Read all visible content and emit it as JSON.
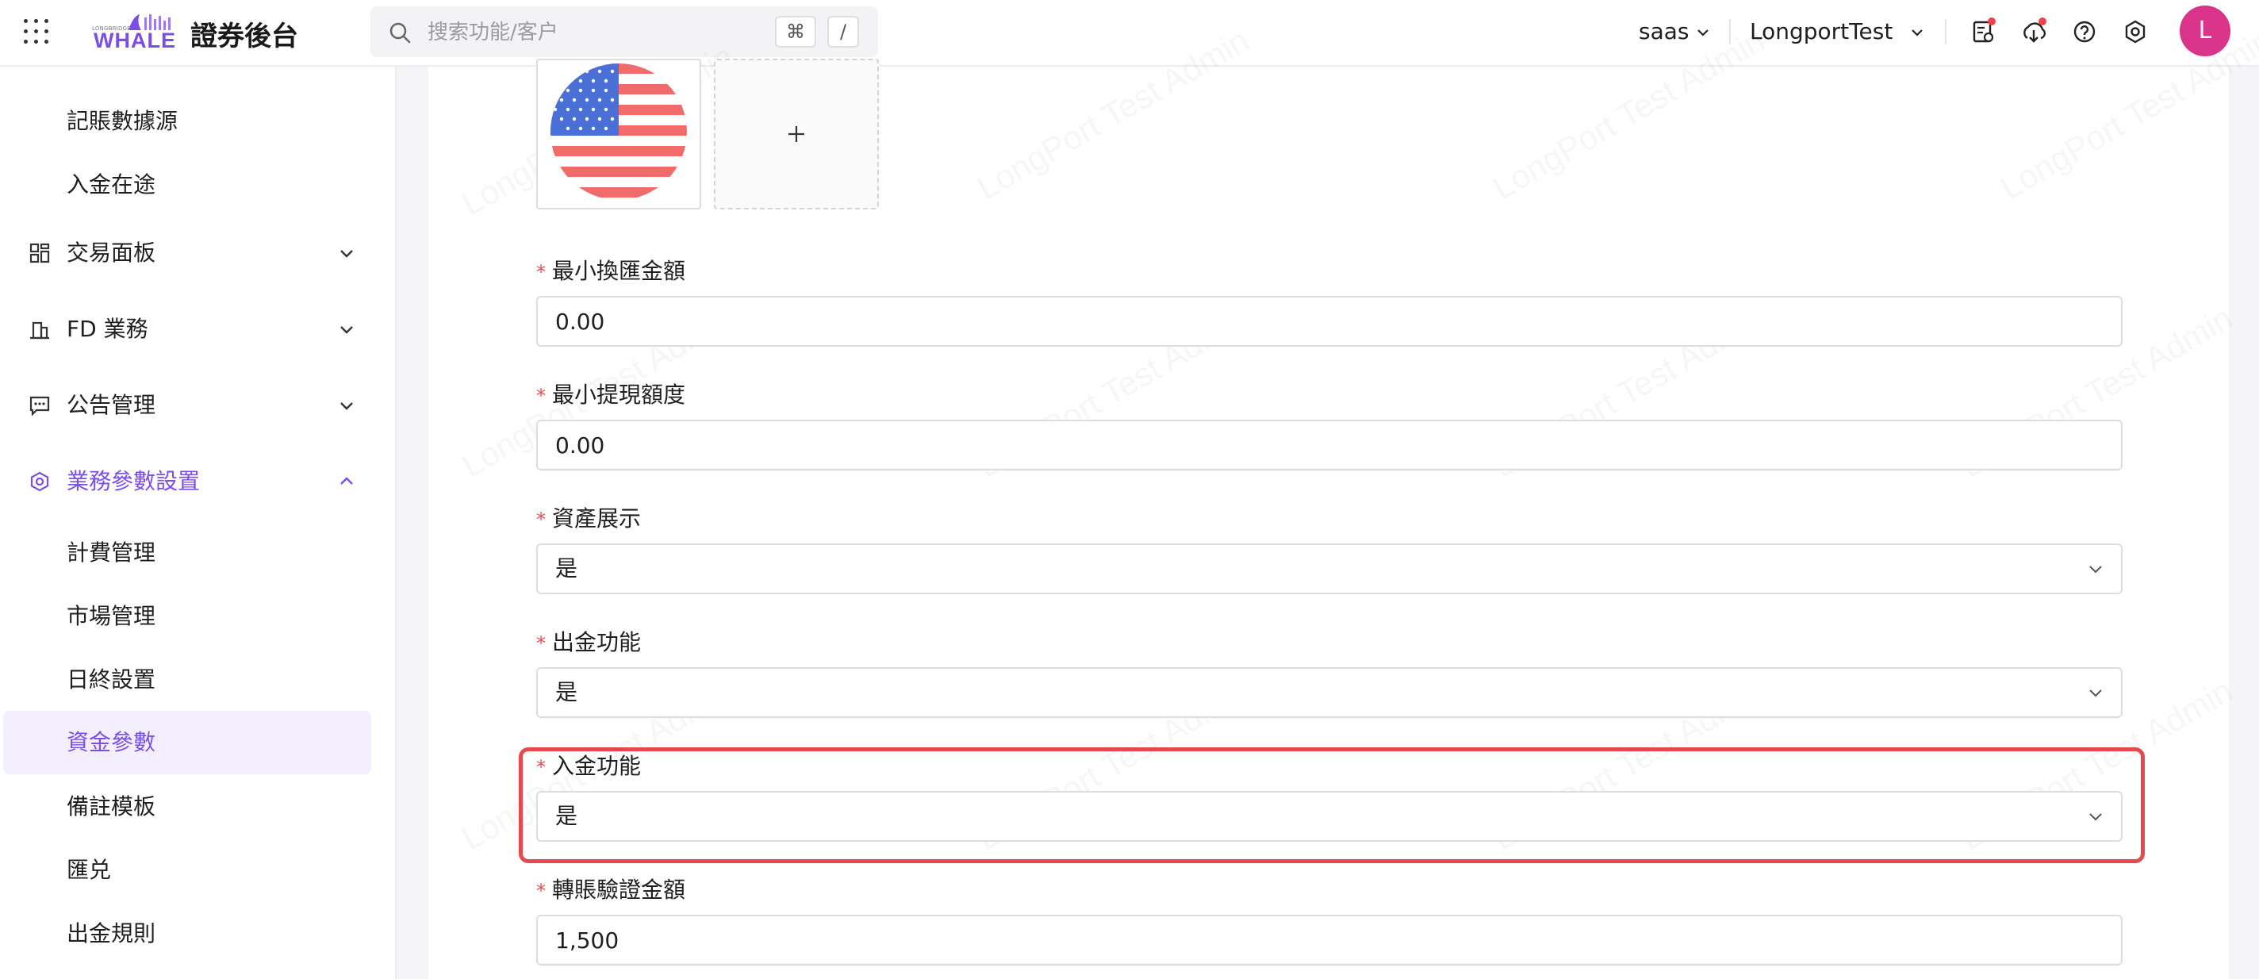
{
  "header": {
    "logo_small_text": "LONGBRIDGE",
    "logo_text": "WHALE",
    "app_title": "證券後台",
    "search_placeholder": "搜索功能/客户",
    "shortcut_key_1": "⌘",
    "shortcut_key_2": "/",
    "tenant_label": "saas",
    "org_label": "LongportTest",
    "avatar_initial": "L",
    "icons": [
      "apps-grid-icon",
      "task-list-icon",
      "download-icon",
      "help-icon",
      "settings-icon"
    ]
  },
  "sidebar": {
    "items": [
      {
        "label": "記賬數據源",
        "type": "sub"
      },
      {
        "label": "入金在途",
        "type": "sub"
      },
      {
        "label": "交易面板",
        "type": "group",
        "icon": "dashboard-icon",
        "expanded": false
      },
      {
        "label": "FD 業務",
        "type": "group",
        "icon": "bank-icon",
        "expanded": false
      },
      {
        "label": "公告管理",
        "type": "group",
        "icon": "announcement-icon",
        "expanded": false
      },
      {
        "label": "業務參數設置",
        "type": "group",
        "icon": "gear-icon",
        "expanded": true,
        "active": true
      },
      {
        "label": "計費管理",
        "type": "sub"
      },
      {
        "label": "市場管理",
        "type": "sub"
      },
      {
        "label": "日終設置",
        "type": "sub"
      },
      {
        "label": "資金參數",
        "type": "sub",
        "selected": true
      },
      {
        "label": "備註模板",
        "type": "sub"
      },
      {
        "label": "匯兑",
        "type": "sub"
      },
      {
        "label": "出金規則",
        "type": "sub"
      }
    ]
  },
  "watermark_text": "LongPort Test Admin",
  "form": {
    "upload_add_icon": "plus-icon",
    "fields": [
      {
        "label": "最小換匯金額",
        "required": true,
        "kind": "input",
        "value": "0.00"
      },
      {
        "label": "最小提現額度",
        "required": true,
        "kind": "input",
        "value": "0.00"
      },
      {
        "label": "資產展示",
        "required": true,
        "kind": "select",
        "value": "是"
      },
      {
        "label": "出金功能",
        "required": true,
        "kind": "select",
        "value": "是"
      },
      {
        "label": "入金功能",
        "required": true,
        "kind": "select",
        "value": "是",
        "highlighted": true
      },
      {
        "label": "轉賬驗證金額",
        "required": true,
        "kind": "input",
        "value": "1,500"
      }
    ]
  },
  "colors": {
    "accent": "#7b4ee8",
    "selected_bg": "#f4efff",
    "required": "#f04b4b",
    "highlight_border": "#e8474c",
    "avatar_bg": "#d9338a",
    "notification_dot": "#f2424a"
  }
}
